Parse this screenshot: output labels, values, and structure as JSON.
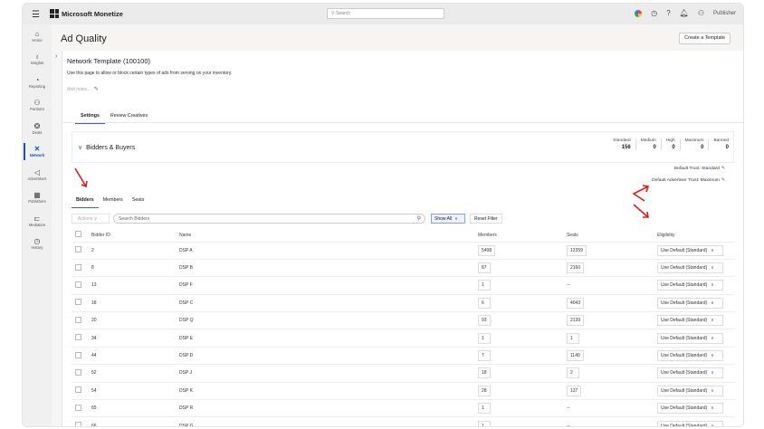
{
  "app": {
    "title": "Microsoft Monetize",
    "search_placeholder": "Search",
    "user": "Publisher"
  },
  "sidebar": {
    "items": [
      {
        "label": "Home",
        "icon": "⌂"
      },
      {
        "label": "Insights",
        "icon": "♁"
      },
      {
        "label": "Reporting",
        "icon": "◔"
      },
      {
        "label": "Partners",
        "icon": "⚇"
      },
      {
        "label": "Deals",
        "icon": "❂"
      },
      {
        "label": "Network",
        "icon": "✕"
      },
      {
        "label": "Advertisers",
        "icon": "◁"
      },
      {
        "label": "Publishers",
        "icon": "▦"
      },
      {
        "label": "Mediation",
        "icon": "⊏"
      },
      {
        "label": "History",
        "icon": "◷"
      }
    ]
  },
  "page": {
    "title": "Ad Quality",
    "create_button": "Create a Template",
    "template_title": "Network Template (100100)",
    "description": "Use this page to allow or block certain types of ads from serving on your inventory.",
    "notes_placeholder": "Add notes...",
    "tabs": [
      "Settings",
      "Review Creatives"
    ]
  },
  "section": {
    "title": "Bidders & Buyers",
    "stats": [
      {
        "label": "Standard",
        "value": "156"
      },
      {
        "label": "Medium",
        "value": "0"
      },
      {
        "label": "High",
        "value": "0"
      },
      {
        "label": "Maximum",
        "value": "0"
      },
      {
        "label": "Banned",
        "value": "0"
      }
    ],
    "default_trust": "Default Trust: Standard",
    "default_adv_trust": "Default Advertiser Trust: Maximum"
  },
  "bidder_tabs": [
    "Bidders",
    "Members",
    "Seats"
  ],
  "toolbar": {
    "actions": "Actions",
    "search_placeholder": "Search Bidders",
    "filter": "Show All",
    "reset": "Reset Filter"
  },
  "table": {
    "headers": [
      "Bidder ID",
      "Name",
      "Members",
      "Seats",
      "Eligibility"
    ],
    "rows": [
      [
        "2",
        "DSP A",
        "5498",
        "12359",
        "Use Default (Standard)"
      ],
      [
        "8",
        "DSP B",
        "87",
        "2160",
        "Use Default (Standard)"
      ],
      [
        "13",
        "DSP F",
        "1",
        "--",
        "Use Default (Standard)"
      ],
      [
        "18",
        "DSP C",
        "6",
        "4043",
        "Use Default (Standard)"
      ],
      [
        "20",
        "DSP Q",
        "93",
        "2139",
        "Use Default (Standard)"
      ],
      [
        "34",
        "DSP E",
        "1",
        "1",
        "Use Default (Standard)"
      ],
      [
        "44",
        "DSP D",
        "7",
        "1140",
        "Use Default (Standard)"
      ],
      [
        "52",
        "DSP J",
        "18",
        "2",
        "Use Default (Standard)"
      ],
      [
        "54",
        "DSP K",
        "28",
        "137",
        "Use Default (Standard)"
      ],
      [
        "65",
        "DSP R",
        "1",
        "--",
        "Use Default (Standard)"
      ],
      [
        "66",
        "DSP G",
        "1",
        "--",
        "Use Default (Standard)"
      ]
    ]
  }
}
